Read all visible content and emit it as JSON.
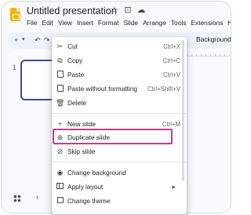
{
  "app": {
    "title": "Untitled presentation",
    "menu": [
      "File",
      "Edit",
      "View",
      "Insert",
      "Format",
      "Slide",
      "Arrange",
      "Tools",
      "Extensions",
      "H"
    ]
  },
  "toolbar": {
    "items": [
      "+",
      "▾",
      "↶",
      "↷",
      "▸"
    ],
    "background_label": "Background"
  },
  "filmstrip": {
    "slide_number": "1"
  },
  "context_menu": {
    "items": [
      {
        "icon": "scissors-icon",
        "label": "Cut",
        "shortcut": "Ctrl+X"
      },
      {
        "icon": "copy-icon",
        "label": "Copy",
        "shortcut": "Ctrl+C"
      },
      {
        "icon": "clipboard-icon",
        "label": "Paste",
        "shortcut": "Ctrl+V"
      },
      {
        "icon": "clipboard-text-icon",
        "label": "Paste without formatting",
        "shortcut": "Ctrl+Shift+V"
      },
      {
        "icon": "trash-icon",
        "label": "Delete",
        "shortcut": ""
      },
      {
        "icon": "plus-icon",
        "label": "New slide",
        "shortcut": "Ctrl+M"
      },
      {
        "icon": "duplicate-icon",
        "label": "Duplicate slide",
        "shortcut": ""
      },
      {
        "icon": "eye-off-icon",
        "label": "Skip slide",
        "shortcut": ""
      },
      {
        "icon": "palette-icon",
        "label": "Change background",
        "shortcut": ""
      },
      {
        "icon": "layout-icon",
        "label": "Apply layout",
        "shortcut": ""
      },
      {
        "icon": "theme-icon",
        "label": "Change theme",
        "shortcut": ""
      }
    ],
    "highlight_color": "#c53d8d"
  }
}
